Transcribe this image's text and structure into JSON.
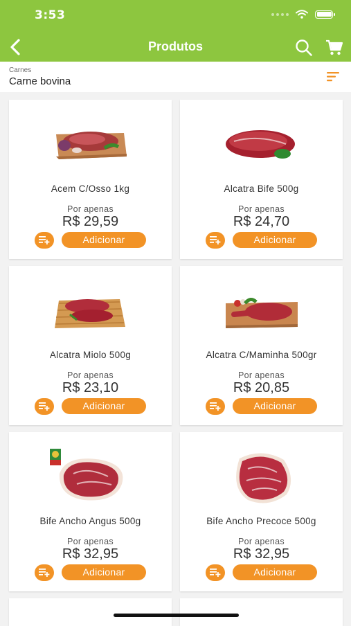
{
  "status": {
    "time": "3:53"
  },
  "header": {
    "title": "Produtos"
  },
  "breadcrumb": {
    "category": "Carnes",
    "subcategory": "Carne bovina"
  },
  "colors": {
    "brand_green": "#8dc63f",
    "accent_orange": "#f29326"
  },
  "products": [
    {
      "name": "Acem C/Osso 1kg",
      "label": "Por apenas",
      "price": "R$ 29,59",
      "add_label": "Adicionar"
    },
    {
      "name": "Alcatra Bife 500g",
      "label": "Por apenas",
      "price": "R$ 24,70",
      "add_label": "Adicionar"
    },
    {
      "name": "Alcatra Miolo 500g",
      "label": "Por apenas",
      "price": "R$ 23,10",
      "add_label": "Adicionar"
    },
    {
      "name": "Alcatra C/Maminha 500gr",
      "label": "Por apenas",
      "price": "R$ 20,85",
      "add_label": "Adicionar"
    },
    {
      "name": "Bife Ancho Angus 500g",
      "label": "Por apenas",
      "price": "R$ 32,95",
      "add_label": "Adicionar"
    },
    {
      "name": "Bife Ancho Precoce 500g",
      "label": "Por apenas",
      "price": "R$ 32,95",
      "add_label": "Adicionar"
    }
  ]
}
